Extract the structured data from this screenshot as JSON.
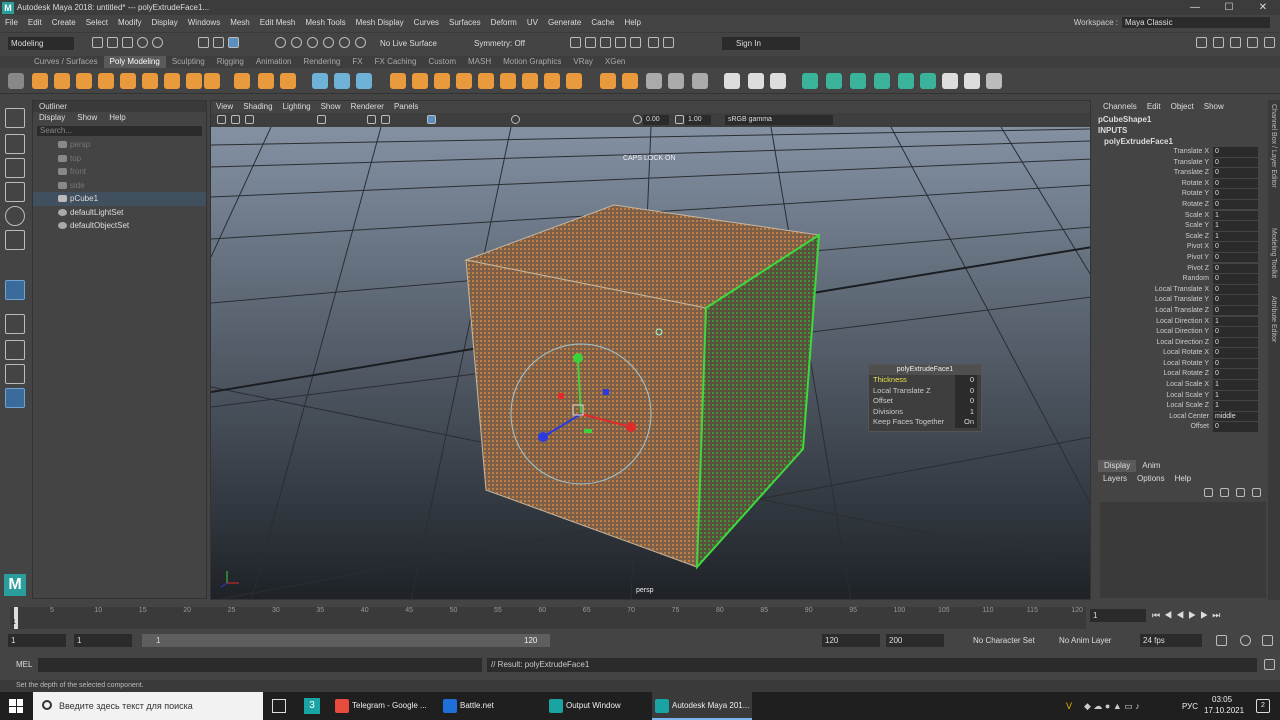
{
  "title_bar": {
    "app_title": "Autodesk Maya 2018: untitled*  ---  polyExtrudeFace1...",
    "minimize": "—",
    "maximize": "☐",
    "close": "✕"
  },
  "menus": [
    "File",
    "Edit",
    "Create",
    "Select",
    "Modify",
    "Display",
    "Windows",
    "Mesh",
    "Edit Mesh",
    "Mesh Tools",
    "Mesh Display",
    "Curves",
    "Surfaces",
    "Deform",
    "UV",
    "Generate",
    "Cache",
    "Help"
  ],
  "workspace": {
    "label": "Workspace :",
    "value": "Maya Classic"
  },
  "status_line": {
    "mode": "Modeling",
    "live_surface": "No Live Surface",
    "symmetry": "Symmetry: Off",
    "sign_in": "Sign In"
  },
  "shelf_tabs": [
    "Curves / Surfaces",
    "Poly Modeling",
    "Sculpting",
    "Rigging",
    "Animation",
    "Rendering",
    "FX",
    "FX Caching",
    "Custom",
    "MASH",
    "Motion Graphics",
    "VRay",
    "XGen"
  ],
  "shelf_active": "Poly Modeling",
  "outliner": {
    "title": "Outliner",
    "menu": [
      "Display",
      "Show",
      "Help"
    ],
    "search_placeholder": "Search...",
    "items": [
      {
        "label": "persp",
        "dim": true
      },
      {
        "label": "top",
        "dim": true
      },
      {
        "label": "front",
        "dim": true
      },
      {
        "label": "side",
        "dim": true
      },
      {
        "label": "pCube1",
        "dim": false,
        "selected": true
      },
      {
        "label": "defaultLightSet",
        "dim": false
      },
      {
        "label": "defaultObjectSet",
        "dim": false
      }
    ]
  },
  "viewport": {
    "menu": [
      "View",
      "Shading",
      "Lighting",
      "Show",
      "Renderer",
      "Panels"
    ],
    "exposure": "0.00",
    "gamma": "1.00",
    "color_space": "sRGB gamma",
    "caps_lock": "CAPS LOCK ON",
    "camera_label": "persp"
  },
  "manip_popup": {
    "title": "polyExtrudeFace1",
    "rows": [
      {
        "label": "Thickness",
        "value": "0"
      },
      {
        "label": "Local Translate Z",
        "value": "0"
      },
      {
        "label": "Offset",
        "value": "0"
      },
      {
        "label": "Divisions",
        "value": "1"
      },
      {
        "label": "Keep Faces Together",
        "value": "On"
      }
    ]
  },
  "channel_box": {
    "menu": [
      "Channels",
      "Edit",
      "Object",
      "Show"
    ],
    "shape": "pCubeShape1",
    "inputs": "INPUTS",
    "node": "polyExtrudeFace1",
    "attrs": [
      {
        "n": "Translate X",
        "v": "0"
      },
      {
        "n": "Translate Y",
        "v": "0"
      },
      {
        "n": "Translate Z",
        "v": "0"
      },
      {
        "n": "Rotate X",
        "v": "0"
      },
      {
        "n": "Rotate Y",
        "v": "0"
      },
      {
        "n": "Rotate Z",
        "v": "0"
      },
      {
        "n": "Scale X",
        "v": "1"
      },
      {
        "n": "Scale Y",
        "v": "1"
      },
      {
        "n": "Scale Z",
        "v": "1"
      },
      {
        "n": "Pivot X",
        "v": "0"
      },
      {
        "n": "Pivot Y",
        "v": "0"
      },
      {
        "n": "Pivot Z",
        "v": "0"
      },
      {
        "n": "Random",
        "v": "0"
      },
      {
        "n": "Local Translate X",
        "v": "0"
      },
      {
        "n": "Local Translate Y",
        "v": "0"
      },
      {
        "n": "Local Translate Z",
        "v": "0"
      },
      {
        "n": "Local Direction X",
        "v": "1"
      },
      {
        "n": "Local Direction Y",
        "v": "0"
      },
      {
        "n": "Local Direction Z",
        "v": "0"
      },
      {
        "n": "Local Rotate X",
        "v": "0"
      },
      {
        "n": "Local Rotate Y",
        "v": "0"
      },
      {
        "n": "Local Rotate Z",
        "v": "0"
      },
      {
        "n": "Local Scale X",
        "v": "1"
      },
      {
        "n": "Local Scale Y",
        "v": "1"
      },
      {
        "n": "Local Scale Z",
        "v": "1"
      },
      {
        "n": "Local Center",
        "v": "middle"
      },
      {
        "n": "Offset",
        "v": "0"
      }
    ]
  },
  "side_tabs": [
    "Channel Box / Layer Editor",
    "Modeling Toolkit",
    "Attribute Editor"
  ],
  "layers": {
    "tabs": [
      "Display",
      "Anim"
    ],
    "menu": [
      "Layers",
      "Options",
      "Help"
    ]
  },
  "timeline": {
    "ticks": [
      "5",
      "10",
      "15",
      "20",
      "25",
      "30",
      "35",
      "40",
      "45",
      "50",
      "55",
      "60",
      "65",
      "70",
      "75",
      "80",
      "85",
      "90",
      "95",
      "100",
      "105",
      "110",
      "115",
      "120"
    ],
    "current_frame": "1"
  },
  "range": {
    "start": "1",
    "anim_start": "1",
    "slider_start": "1",
    "slider_end": "120",
    "end": "120",
    "anim_end": "200",
    "character_set": "No Character Set",
    "anim_layer": "No Anim Layer",
    "fps": "24 fps"
  },
  "command": {
    "lang": "MEL",
    "result": "// Result: polyExtrudeFace1"
  },
  "help_line": "Set the depth of the selected component.",
  "taskbar": {
    "search": "Введите здесь текст для поиска",
    "apps": [
      {
        "label": "Telegram - Google ...",
        "color": "#e84b3c"
      },
      {
        "label": "Battle.net",
        "color": "#1e6fd9"
      },
      {
        "label": "Output Window",
        "color": "#1aa3a3"
      },
      {
        "label": "Autodesk Maya 201...",
        "color": "#1aa3a3"
      }
    ],
    "lang": "РУС",
    "time": "03:05",
    "date": "17.10.2021",
    "notif": "2"
  },
  "colors": {
    "viewport_sky": "#6f7e90",
    "cube_face": "#7a6250",
    "selection_green": "#3dd93d",
    "accent": "#2a9d9d"
  }
}
